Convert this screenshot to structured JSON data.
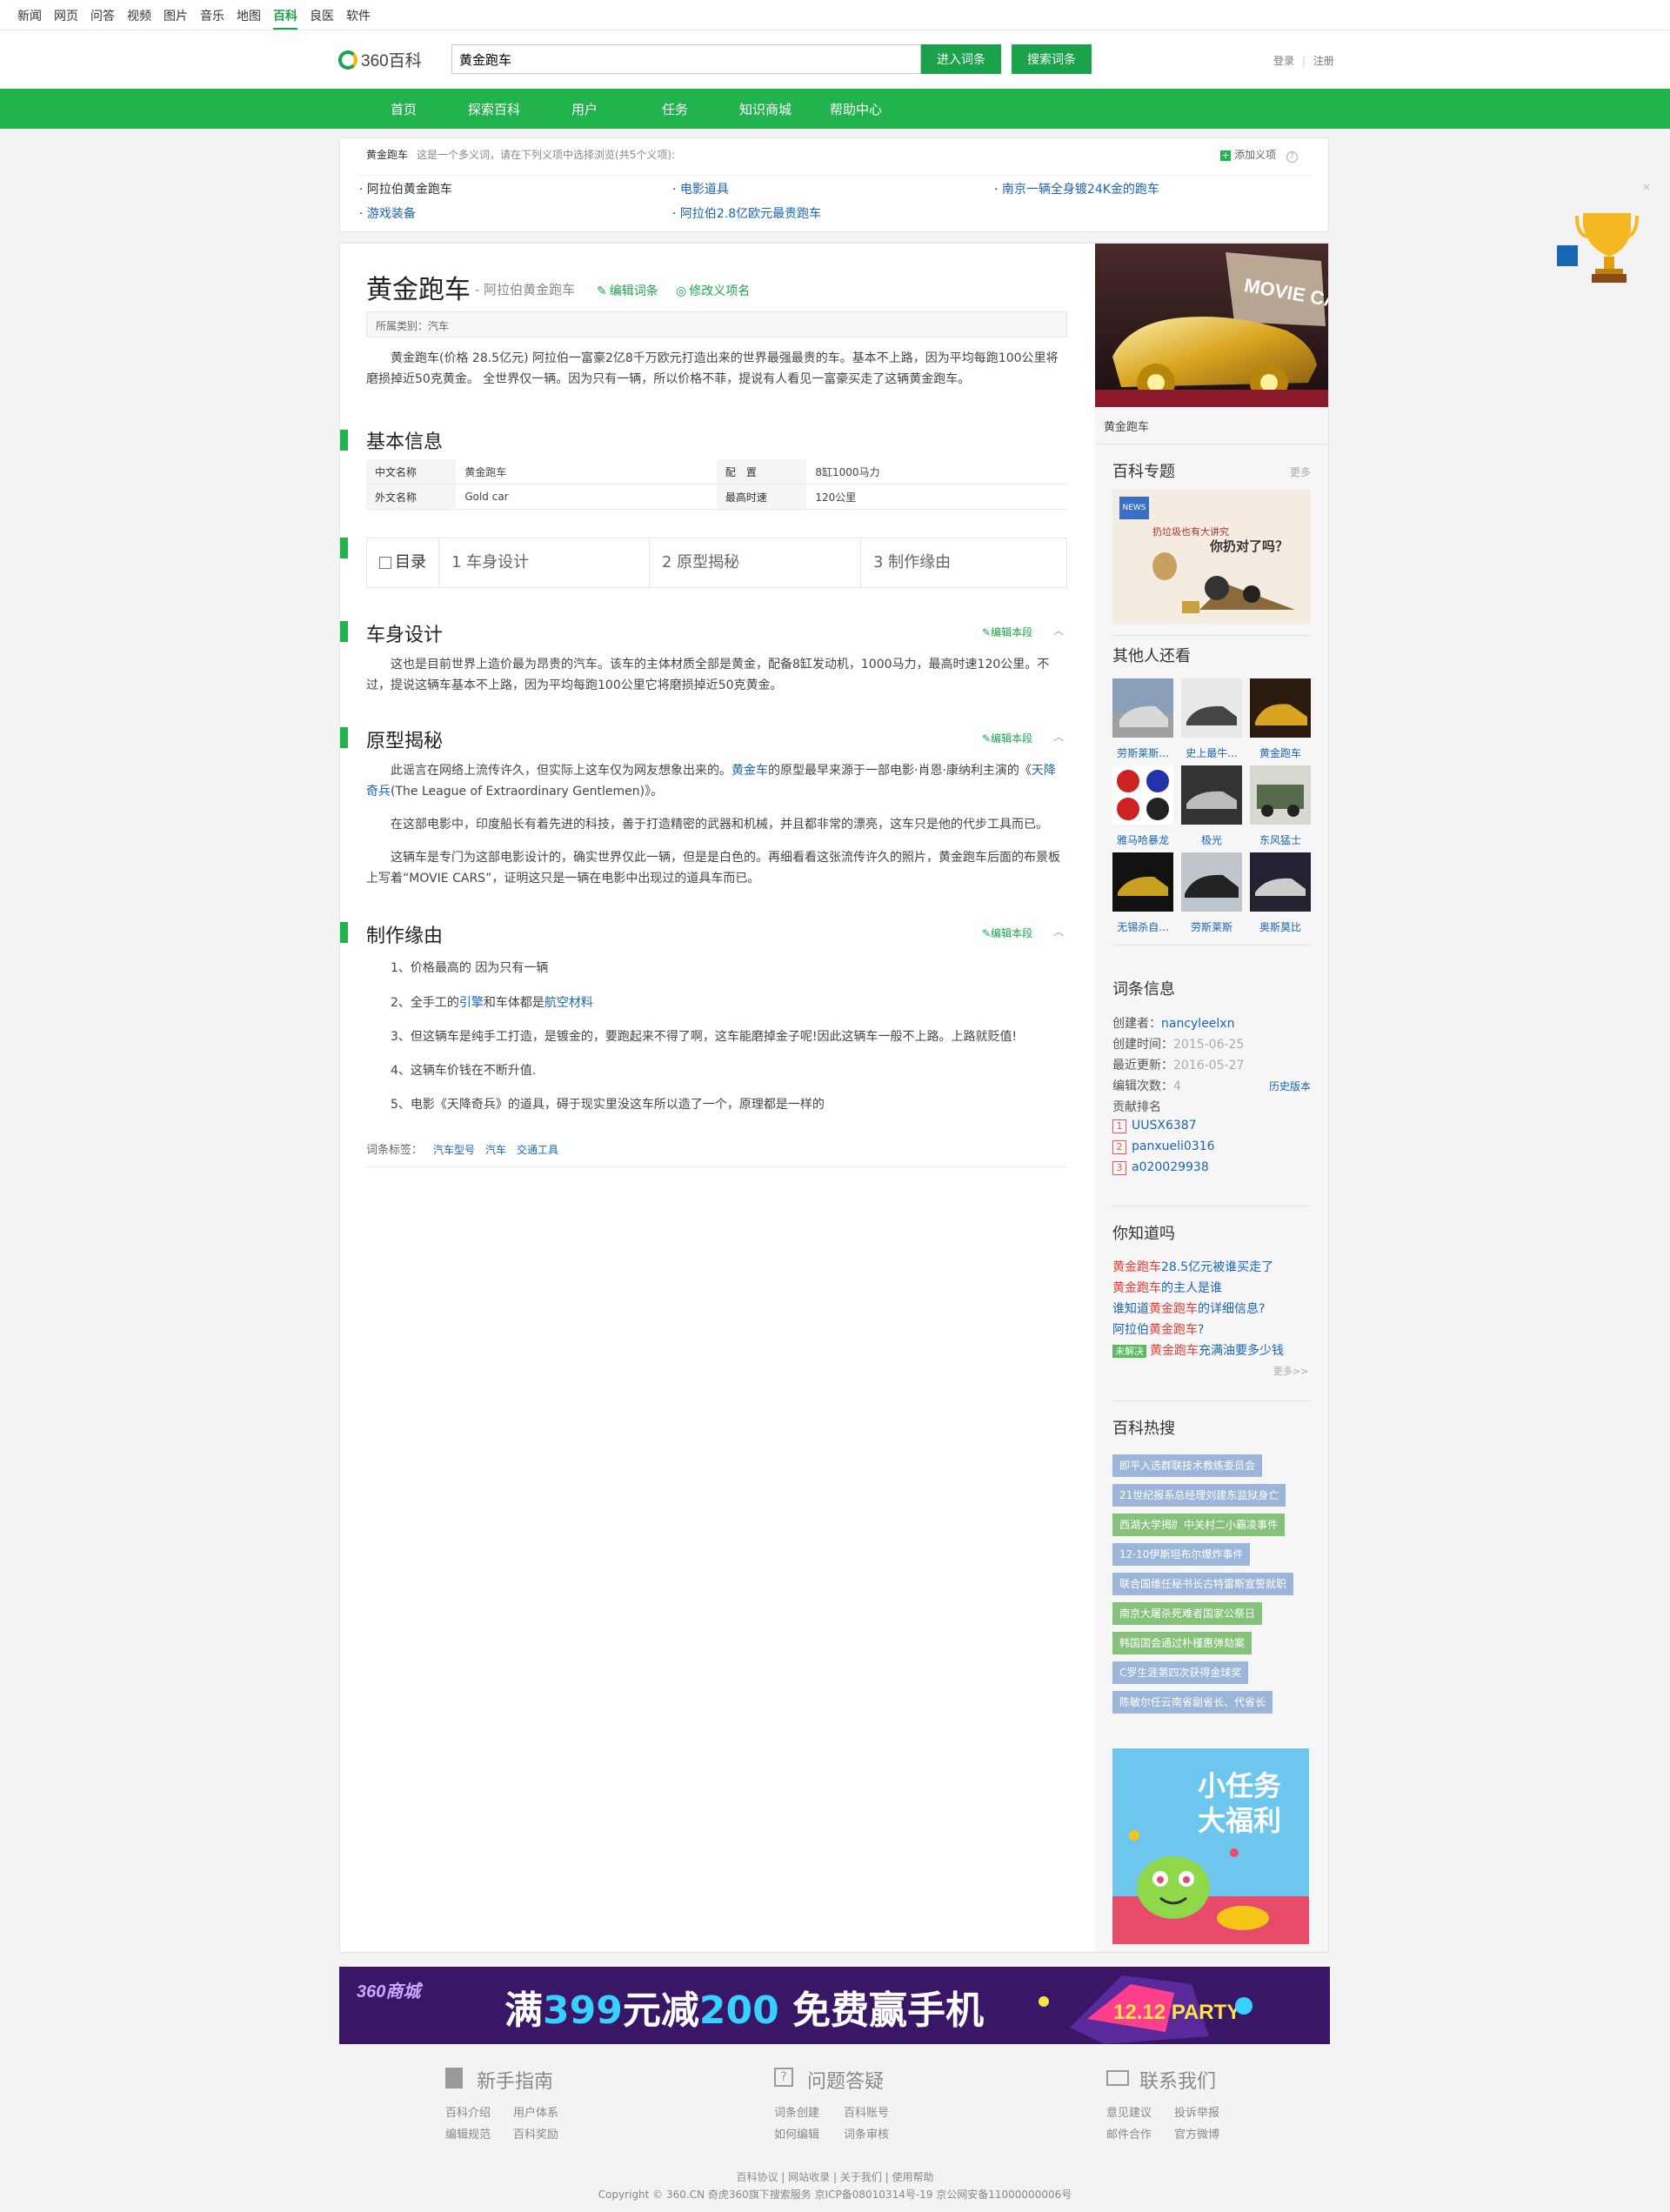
{
  "topnav": [
    "新闻",
    "网页",
    "问答",
    "视频",
    "图片",
    "音乐",
    "地图",
    "百科",
    "良医",
    "软件"
  ],
  "topnav_active": "百科",
  "logo_text": "360百科",
  "search": {
    "value": "黄金跑车",
    "enter_label": "进入词条",
    "search_label": "搜索词条"
  },
  "auth": {
    "login": "登录",
    "register": "注册"
  },
  "mainnav": [
    "首页",
    "探索百科",
    "用户",
    "任务",
    "知识商城",
    "帮助中心"
  ],
  "disambig": {
    "term": "黄金跑车",
    "hint": "这是一个多义词，请在下列义项中选择浏览(共5个义项):",
    "add_label": "添加义项",
    "items": [
      "阿拉伯黄金跑车",
      "电影道具",
      "南京一辆全身镀24K金的跑车",
      "游戏装备",
      "阿拉伯2.8亿欧元最贵跑车"
    ]
  },
  "entry": {
    "title": "黄金跑车",
    "subtitle": "- 阿拉伯黄金跑车",
    "edit_entry": "编辑词条",
    "edit_name": "修改义项名",
    "category": "所属类别：汽车",
    "summary": "黄金跑车(价格 28.5亿元) 阿拉伯一富豪2亿8千万欧元打造出来的世界最强最贵的车。基本不上路，因为平均每跑100公里将磨损掉近50克黄金。 全世界仅一辆。因为只有一辆，所以价格不菲，提说有人看见一富豪买走了这辆黄金跑车。"
  },
  "basic_info": {
    "title": "基本信息",
    "rows": [
      {
        "k1": "中文名称",
        "v1": "黄金跑车",
        "k2": "配　置",
        "v2": "8缸1000马力"
      },
      {
        "k1": "外文名称",
        "v1": "Gold car",
        "k2": "最高时速",
        "v2": "120公里"
      }
    ]
  },
  "toc": {
    "label": "目录",
    "items": [
      "1 车身设计",
      "2 原型揭秘",
      "3 制作缘由"
    ]
  },
  "sections": {
    "edit_label": "编辑本段",
    "s1": {
      "title": "车身设计",
      "text": "这也是目前世界上造价最为昂贵的汽车。该车的主体材质全部是黄金，配备8缸发动机，1000马力，最高时速120公里。不过，提说这辆车基本不上路，因为平均每跑100公里它将磨损掉近50克黄金。"
    },
    "s2": {
      "title": "原型揭秘",
      "p1a": "此谣言在网络上流传许久，但实际上这车仅为网友想象出来的。",
      "p1link1": "黄金车",
      "p1b": "的原型最早来源于一部电影·肖恩·康纳利主演的《",
      "p1link2": "天降奇兵",
      "p1c": "(The League of Extraordinary Gentlemen)》。",
      "p2": "在这部电影中，印度船长有着先进的科技，善于打造精密的武器和机械，并且都非常的漂亮，这车只是他的代步工具而已。",
      "p3": "这辆车是专门为这部电影设计的，确实世界仅此一辆，但是是白色的。再细看看这张流传许久的照片，黄金跑车后面的布景板上写着“MOVIE CARS”，证明这只是一辆在电影中出现过的道具车而已。"
    },
    "s3": {
      "title": "制作缘由",
      "i1": "1、价格最高的 因为只有一辆",
      "i2a": "2、全手工的",
      "i2link1": "引擎",
      "i2b": "和车体都是",
      "i2link2": "航空材料",
      "i3": "3、但这辆车是纯手工打造，是镀金的，要跑起来不得了啊，这车能磨掉金子呢!因此这辆车一般不上路。上路就贬值!",
      "i4": "4、这辆车价钱在不断升值.",
      "i5": "5、电影《天降奇兵》的道具，碍于现实里没这车所以造了一个，原理都是一样的"
    }
  },
  "tags": {
    "label": "词条标签：",
    "items": [
      "汽车型号",
      "汽车",
      "交通工具"
    ]
  },
  "sidebar": {
    "image_caption": "黄金跑车",
    "topic_title": "百科专题",
    "topic_more": "更多",
    "topic_text": "扔垃圾也有大讲究",
    "topic_text2": "你扔对了吗？",
    "others_title": "其他人还看",
    "others": [
      "劳斯莱斯...",
      "史上最牛...",
      "黄金跑车",
      "雅马哈暴龙",
      "极光",
      "东风猛士",
      "无锡杀自...",
      "劳斯莱斯",
      "奥斯莫比"
    ],
    "entryinfo_title": "词条信息",
    "creator_label": "创建者：",
    "creator": "nancyleelxn",
    "created_label": "创建时间：",
    "created": "2015-06-25",
    "updated_label": "最近更新：",
    "updated": "2016-05-27",
    "edits_label": "编辑次数：",
    "edits": "4",
    "history": "历史版本",
    "contrib_label": "贡献排名",
    "contribs": [
      "UUSX6387",
      "panxueli0316",
      "a020029938"
    ],
    "dyk_title": "你知道吗",
    "dyk": [
      {
        "hl": "黄金跑车",
        "rest": "28.5亿元被谁买走了"
      },
      {
        "hl": "黄金跑车",
        "rest": "的主人是谁"
      },
      {
        "pre": "谁知道",
        "hl": "黄金跑车",
        "rest": "的详细信息?"
      },
      {
        "pre": "阿拉伯",
        "hl": "黄金跑车",
        "rest": "?"
      },
      {
        "tag": "未解决",
        "hl": "黄金跑车",
        "rest": "充满油要多少钱"
      }
    ],
    "dyk_more": "更多>>",
    "hot_title": "百科热搜",
    "hot": [
      "即平入选群联技术教练委员会",
      "21世纪报系总经理刘建东监狱身亡",
      "西湖大学揭牌",
      "中关村二小霸凌事件",
      "12·10伊斯坦布尔爆炸事件",
      "联合国维任秘书长古特雷斯宣誓就职",
      "南京大屠杀死难者国家公祭日",
      "韩国国会通过朴槿惠弹劾案",
      "C罗生涯第四次获得金球奖",
      "陈敏尔任云南省副省长、代省长"
    ],
    "promo_line1": "小任务",
    "promo_line2": "大福利"
  },
  "banner": {
    "brand": "360商城",
    "text_a": "满",
    "text_b": "399",
    "text_c": "元减",
    "text_d": "200",
    "text_e": " 免费赢手机",
    "party": "12.12 PARTY"
  },
  "footer": {
    "cols": [
      {
        "title": "新手指南",
        "links": [
          "百科介绍",
          "用户体系",
          "编辑规范",
          "百科奖励"
        ]
      },
      {
        "title": "问题答疑",
        "links": [
          "词条创建",
          "百科账号",
          "如何编辑",
          "词条审核"
        ]
      },
      {
        "title": "联系我们",
        "links": [
          "意见建议",
          "投诉举报",
          "邮件合作",
          "官方微博"
        ]
      }
    ],
    "links_line": "百科协议 | 网站收录 | 关于我们 | 使用帮助",
    "copyright": "Copyright © 360.CN 奇虎360旗下搜索服务 京ICP备08010314号-19 京公网安备11000000006号"
  },
  "colors": {
    "brand_green": "#22b34e",
    "link_blue": "#1a64b4",
    "banner_purple": "#3a1667",
    "highlight_red": "#e53935"
  }
}
